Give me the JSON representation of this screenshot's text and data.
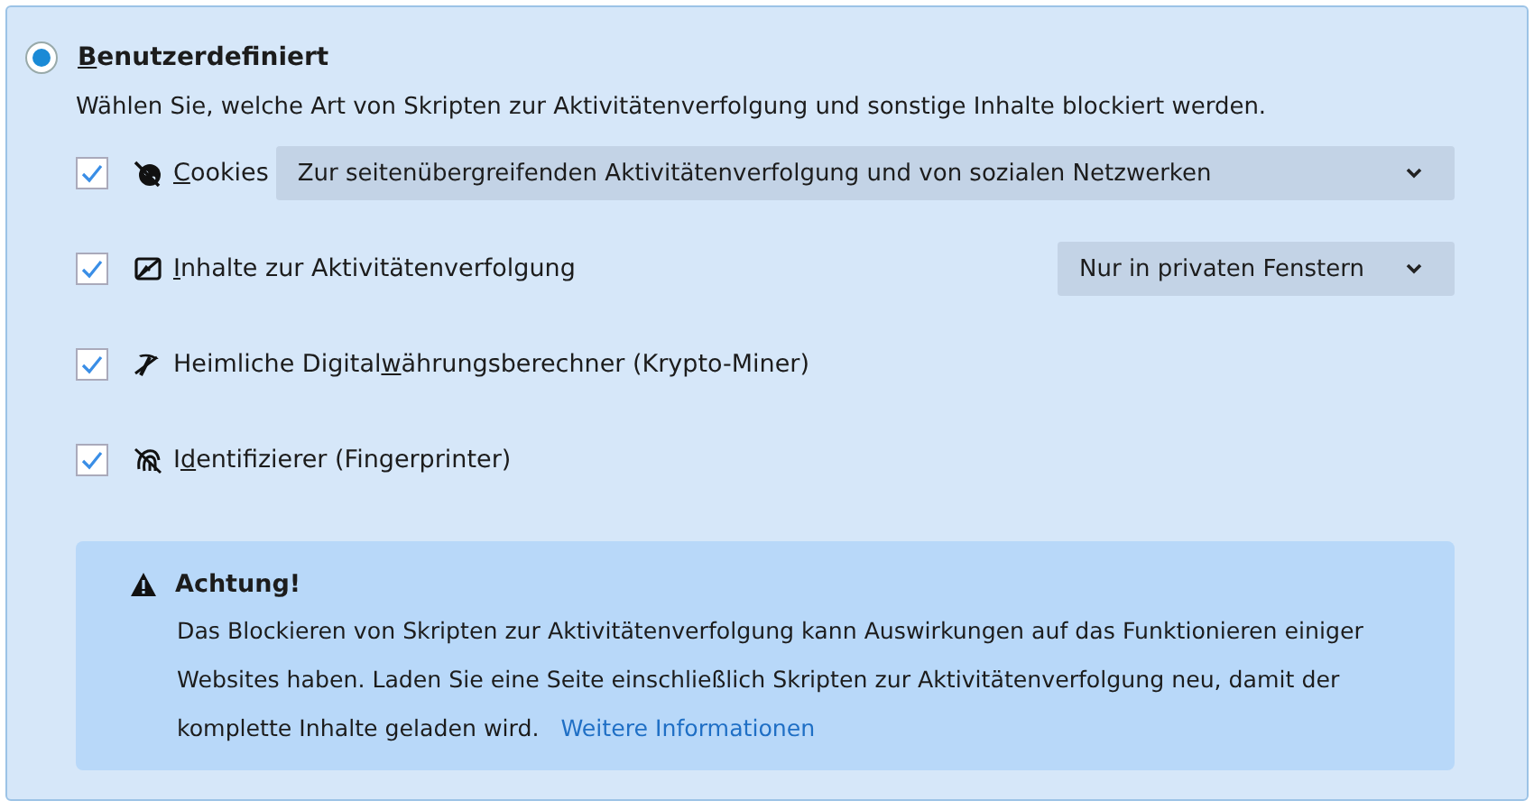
{
  "option": {
    "selected": true,
    "label": {
      "key": "B",
      "post": "enutzerdefiniert"
    }
  },
  "description": "Wählen Sie, welche Art von Skripten zur Aktivitätenverfolgung und sonstige Inhalte blockiert werden.",
  "rows": [
    {
      "kind": "cookies",
      "checked": true,
      "label": {
        "key": "C",
        "post": "ookies"
      },
      "select": {
        "value": "Zur seitenübergreifenden Aktivitätenverfolgung und von sozialen Netzwerken",
        "wide": true
      }
    },
    {
      "kind": "tracking",
      "checked": true,
      "label": {
        "key": "I",
        "post": "nhalte zur Aktivitätenverfolgung"
      },
      "select": {
        "value": "Nur in privaten Fenstern",
        "wide": false
      }
    },
    {
      "kind": "miner",
      "checked": true,
      "label": {
        "pre": "Heimliche Digital",
        "key": "w",
        "post": "ährungsberechner (Krypto-Miner)"
      }
    },
    {
      "kind": "fingerprint",
      "checked": true,
      "label": {
        "pre": "I",
        "key": "d",
        "post": "entifizierer (Fingerprinter)"
      }
    }
  ],
  "warning": {
    "title": "Achtung!",
    "text": "Das Blockieren von Skripten zur Aktivitätenverfolgung kann Auswirkungen auf das Funktionieren einiger Websites haben. Laden Sie eine Seite einschließlich Skripten zur Aktivitätenverfolgung neu, damit der komplette Inhalte geladen wird.",
    "link": "Weitere Informationen"
  }
}
